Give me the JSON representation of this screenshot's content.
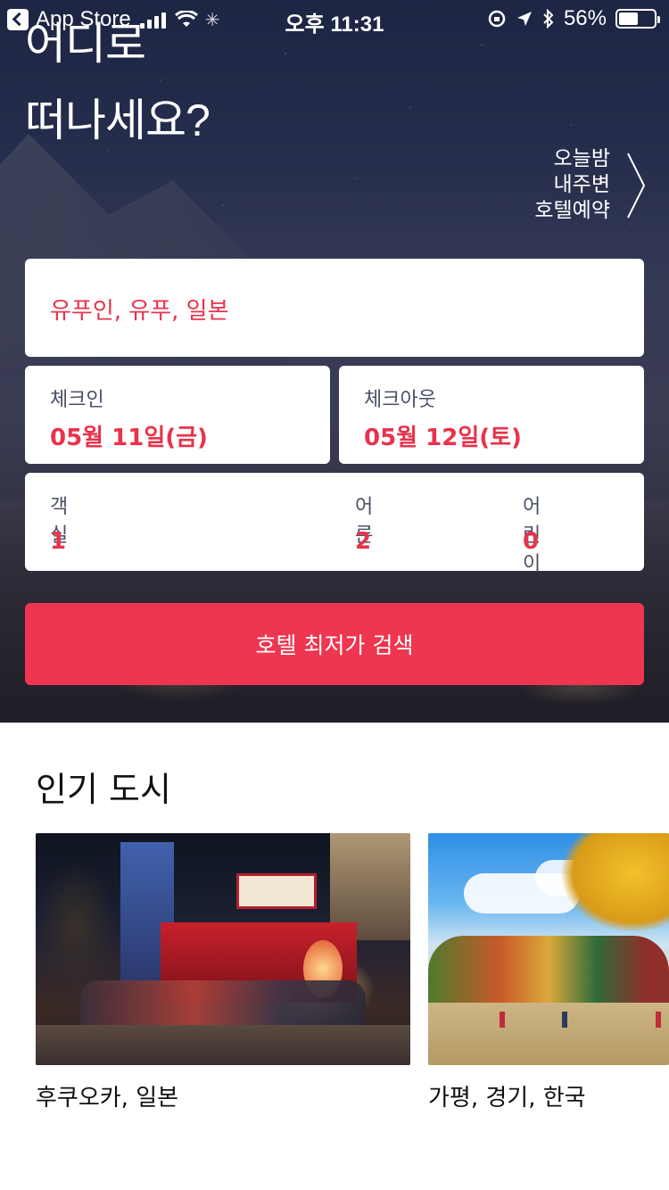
{
  "status_bar": {
    "back_app": "App Store",
    "time": "오후 11:31",
    "battery_percent": "56%",
    "battery_level": 0.56,
    "icons": [
      "signal-icon",
      "wifi-icon",
      "activity-spinner-icon",
      "orientation-lock-icon",
      "location-arrow-icon",
      "bluetooth-icon",
      "battery-icon"
    ]
  },
  "hero": {
    "title_line1": "어디로",
    "title_line2": "떠나세요?",
    "tonight_link": {
      "line1": "오늘밤",
      "line2": "내주변",
      "line3": "호텔예약"
    }
  },
  "search_form": {
    "destination": "유푸인, 유푸, 일본",
    "checkin": {
      "label": "체크인",
      "value": "05월 11일(금)"
    },
    "checkout": {
      "label": "체크아웃",
      "value": "05월 12일(토)"
    },
    "rooms": {
      "label": "객실",
      "value": "1"
    },
    "adults": {
      "label": "어른",
      "value": "2"
    },
    "children": {
      "label": "어린이",
      "value": "0"
    },
    "search_button": "호텔 최저가 검색"
  },
  "popular_cities": {
    "title": "인기 도시",
    "items": [
      {
        "name": "후쿠오카, 일본"
      },
      {
        "name": "가평, 경기, 한국"
      }
    ]
  },
  "colors": {
    "accent": "#ee3650",
    "value_text": "#e8334c",
    "label_text": "#4a5066"
  }
}
